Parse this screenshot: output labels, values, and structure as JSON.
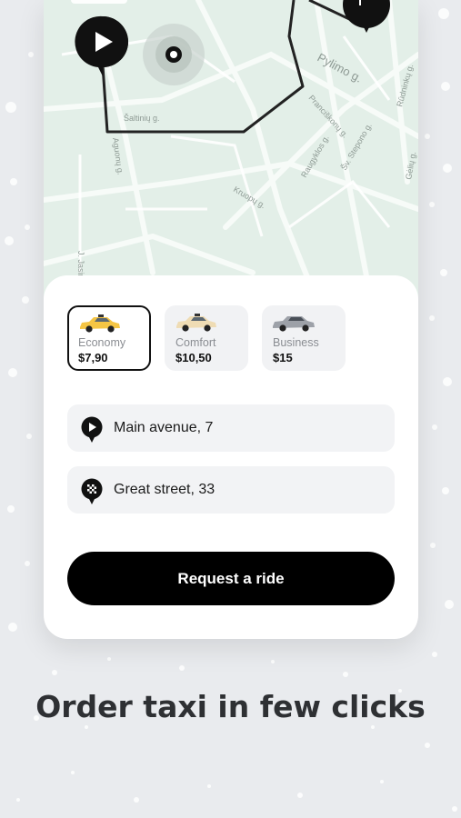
{
  "map": {
    "streets": [
      "Pylimo g.",
      "Šaltinių g.",
      "Aguonų g.",
      "Pranciškonų g.",
      "Raugyklos g.",
      "Šv. Stepono g.",
      "Kruopų g.",
      "Gėlių g.",
      "Rūdninkų g.",
      "J. Jasinskio g."
    ],
    "start_marker_icon": "play-icon",
    "destination_marker_icon": "checkered-flag-icon",
    "current_location_icon": "location-dot-icon"
  },
  "ride_options": [
    {
      "name": "Economy",
      "price": "$7,90",
      "car_color": "#f5c544",
      "selected": true
    },
    {
      "name": "Comfort",
      "price": "$10,50",
      "car_color": "#efdcb4",
      "selected": false
    },
    {
      "name": "Business",
      "price": "$15",
      "car_color": "#9da1a8",
      "selected": false
    }
  ],
  "pickup": {
    "address": "Main avenue, 7",
    "icon": "play-pin-icon"
  },
  "destination": {
    "address": "Great street, 33",
    "icon": "checkered-pin-icon"
  },
  "cta": {
    "label": "Request a ride"
  },
  "headline": "Order taxi in few clicks"
}
